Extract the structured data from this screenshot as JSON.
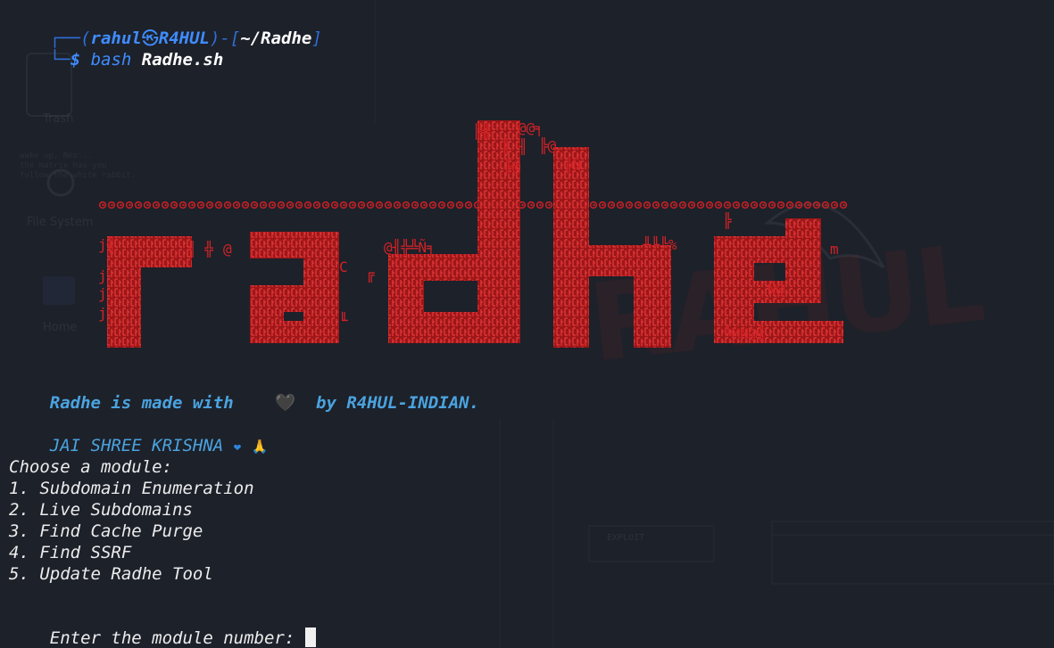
{
  "prompt": {
    "corner_top": "┌──(",
    "user": "rahul",
    "skull": "㉿",
    "host": "R4HUL",
    "mid": ")-[",
    "dir": "~/Radhe",
    "end": "]",
    "corner_bottom": "└─",
    "dollar": "$",
    "command": "bash",
    "argument": "Radhe.sh"
  },
  "banner": {
    "logo_text": "radhe",
    "fill_glyphs": "╢╣╬@╫▓░║╟╠",
    "top_row": "m@@@@@@@@@@@@@@@@@@@@@@@@@@@@@@@@@@@@@@@@@@@@@@@@╣  @@@@╢ @@@@@@@@@@@@@@@@@@@@@@@@@@@@@@@@@@@N╕",
    "color": "#d42226"
  },
  "credit": {
    "prefix": "Radhe is made with",
    "heart": "🖤",
    "suffix": "by R4HUL-INDIAN."
  },
  "greeting": {
    "text": "JAI SHREE KRISHNA",
    "heart": "❤",
    "emoji": "🙏"
  },
  "menu": {
    "title": "Choose a module:",
    "items": [
      "1. Subdomain Enumeration",
      "2. Live Subdomains",
      "3. Find Cache Purge",
      "4. Find SSRF",
      "5. Update Radhe Tool"
    ]
  },
  "input": {
    "prompt": "Enter the module number: "
  },
  "wallpaper": {
    "trash_label": "Trash",
    "filesystem_label": "File System",
    "home_label": "Home",
    "matrix_text": "wake up, Neo...\nthe matrix has you\nfollow the white rabbit.",
    "exploit_label": "EXPLOIT",
    "brand_text": "RAHUL"
  }
}
